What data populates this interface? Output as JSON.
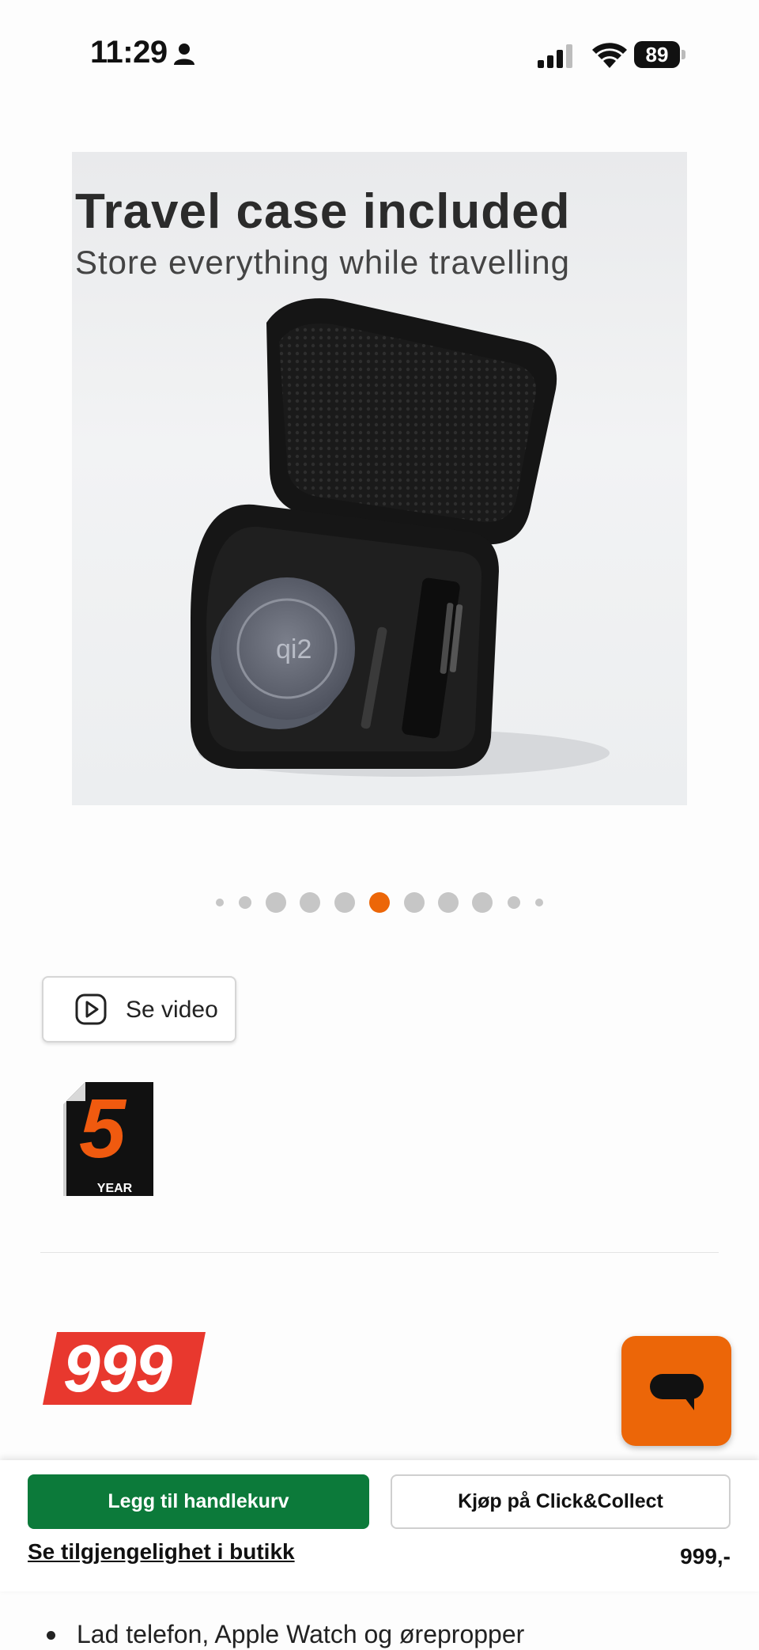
{
  "status_bar": {
    "time": "11:29",
    "battery": "89",
    "icons": [
      "person-icon",
      "cellular-signal-icon",
      "wifi-icon",
      "battery-icon"
    ]
  },
  "product_image": {
    "headline": "Travel case included",
    "subline": "Store everything while travelling",
    "charger_logo": "qi2"
  },
  "carousel": {
    "total_dots": 11,
    "active_index": 5,
    "active_color": "#ec6608",
    "inactive_color": "#c6c6c6"
  },
  "video_button": {
    "label": "Se video",
    "icon": "play-icon"
  },
  "warranty_badge": {
    "number": "5",
    "label": "YEAR"
  },
  "price_badge": {
    "value": "999",
    "color": "#e8382e"
  },
  "chat_button": {
    "icon": "chat-bubble-icon",
    "color": "#ec6608"
  },
  "bottom_bar": {
    "add_to_cart_label": "Legg til handlekurv",
    "add_to_cart_color": "#0c7a3a",
    "click_collect_label": "Kjøp på Click&Collect",
    "store_availability_label": "Se tilgjengelighet i butikk",
    "price": "999,-"
  },
  "features": [
    "Lad telefon, Apple Watch og ørepropper"
  ]
}
